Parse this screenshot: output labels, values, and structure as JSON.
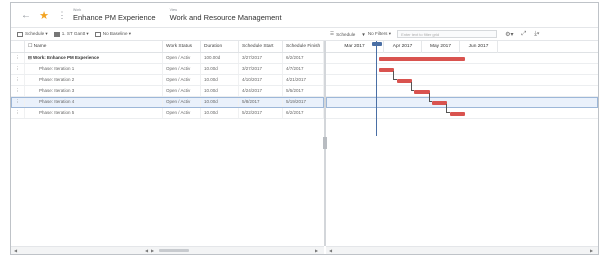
{
  "header": {
    "work_label": "Work",
    "work_title": "Enhance PM Experience",
    "view_label": "View",
    "view_title": "Work and Resource Management"
  },
  "toolbar_left": {
    "schedule_label": "Schedule ▾",
    "gantt_label": "1. ST Gantt ▾",
    "baseline_label": "No Baseline ▾"
  },
  "toolbar_right": {
    "schedule_label": "Schedule",
    "filter_label": "No Filters ▾",
    "filter_placeholder": "Enter text to filter grid"
  },
  "grid": {
    "columns": [
      "Name",
      "Work Status",
      "Duration",
      "Schedule Start",
      "Schedule Finish"
    ],
    "rows": [
      {
        "name": "Work: Enhance PM Experience",
        "status": "Open / Activ",
        "duration": "100.00d",
        "start": "3/27/2017",
        "finish": "6/2/2017",
        "summary": true
      },
      {
        "name": "Phase: Iteration 1",
        "status": "Open / Activ",
        "duration": "10.00d",
        "start": "3/27/2017",
        "finish": "4/7/2017",
        "summary": false
      },
      {
        "name": "Phase: Iteration 2",
        "status": "Open / Activ",
        "duration": "10.00d",
        "start": "4/10/2017",
        "finish": "4/21/2017",
        "summary": false
      },
      {
        "name": "Phase: Iteration 3",
        "status": "Open / Activ",
        "duration": "10.00d",
        "start": "4/24/2017",
        "finish": "5/5/2017",
        "summary": false
      },
      {
        "name": "Phase: Iteration 4",
        "status": "Open / Activ",
        "duration": "10.00d",
        "start": "5/8/2017",
        "finish": "5/19/2017",
        "summary": false,
        "selected": true
      },
      {
        "name": "Phase: Iteration 5",
        "status": "Open / Activ",
        "duration": "10.00d",
        "start": "5/22/2017",
        "finish": "6/2/2017",
        "summary": false
      }
    ]
  },
  "gantt": {
    "months": [
      "Mar 2017",
      "Apr 2017",
      "May 2017",
      "Jun 2017"
    ],
    "bar_color": "#d9534f",
    "today_color": "#4a6fa5"
  },
  "icons": {
    "back": "arrow-left-icon",
    "star": "star-icon",
    "menu": "kebab-icon",
    "settings": "gear-icon",
    "expand": "expand-icon",
    "download": "download-icon"
  }
}
